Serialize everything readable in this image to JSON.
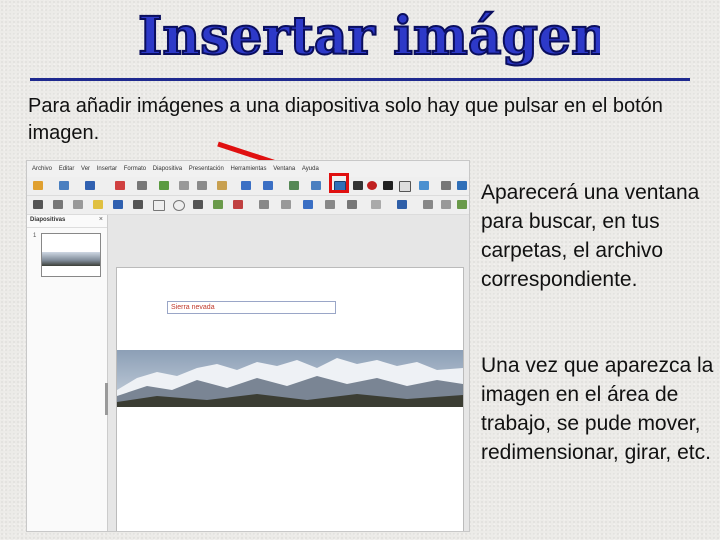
{
  "slide": {
    "title": "Insertar imágenes",
    "intro": "Para añadir imágenes a una diapositiva solo hay que pulsar en el botón imagen.",
    "paragraph1": "Aparecerá una ventana para buscar, en tus carpetas, el archivo correspondiente.",
    "paragraph2": "Una vez que aparezca la imagen en el área de trabajo, se pude mover, redimensionar, girar, etc.",
    "accent_color": "#2d39c8",
    "arrow_color": "#e01010"
  },
  "app": {
    "menu": [
      "Archivo",
      "Editar",
      "Ver",
      "Insertar",
      "Formato",
      "Diapositiva",
      "Presentación",
      "Herramientas",
      "Ventana",
      "Ayuda"
    ],
    "panel_title": "Diapositivas",
    "panel_close": "×",
    "thumb_number": "1",
    "image_caption": "Sierra nevada",
    "highlighted_tool": "image-icon"
  }
}
